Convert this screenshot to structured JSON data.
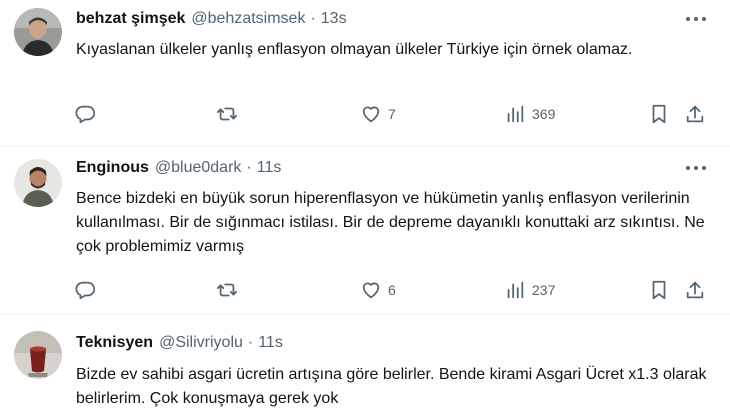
{
  "tweets": [
    {
      "name": "behzat şimşek",
      "handle": "@behzatsimsek",
      "time": "13s",
      "text": "Kıyaslanan ülkeler yanlış enflasyon olmayan ülkeler Türkiye için örnek olamaz.",
      "likes": "7",
      "views": "369"
    },
    {
      "name": "Enginous",
      "handle": "@blue0dark",
      "time": "11s",
      "text": "Bence bizdeki en büyük sorun hiperenflasyon ve hükümetin yanlış enflasyon verilerinin kullanılması. Bir de sığınmacı istilası. Bir de depreme dayanıklı konuttaki arz sıkıntısı. Ne çok problemimiz varmış",
      "likes": "6",
      "views": "237"
    },
    {
      "name": "Teknisyen",
      "handle": "@Silivriyolu",
      "time": "11s",
      "text": "Bizde ev sahibi asgari ücretin artışına göre belirler.  Bende kirami Asgari Ücret x1.3 olarak belirlerim.  Çok konuşmaya gerek yok"
    }
  ],
  "separator": "·",
  "icons": {
    "reply": "speech-bubble",
    "retweet": "two-arrows-loop",
    "like": "heart",
    "views": "bar-chart",
    "bookmark": "bookmark",
    "share": "upload-arrow",
    "more": "three-dots"
  },
  "colors": {
    "text": "#0f1419",
    "secondary": "#536471",
    "divider": "#eff3f4"
  }
}
